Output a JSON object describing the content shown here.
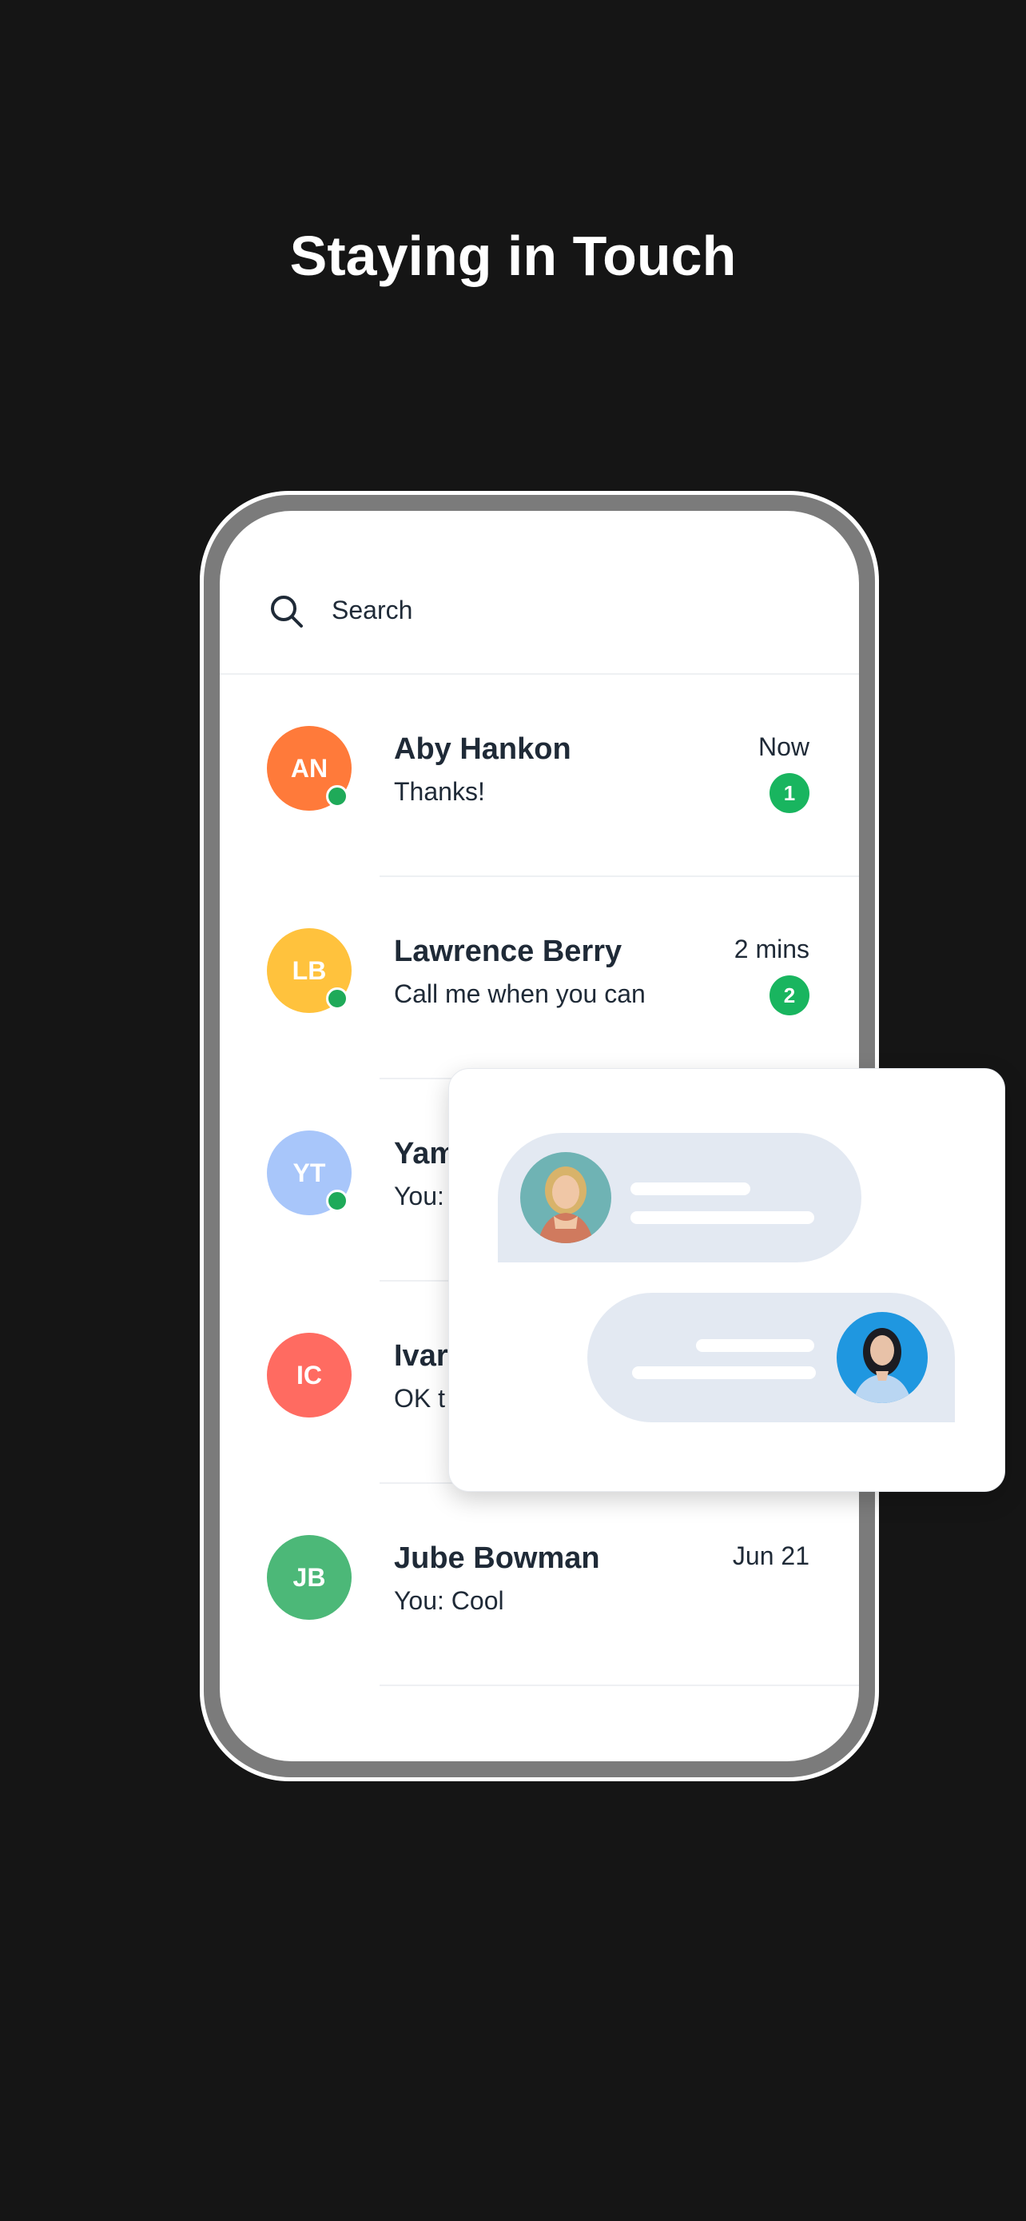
{
  "headline": "Staying in Touch",
  "search": {
    "placeholder": "Search"
  },
  "conversations": [
    {
      "initials": "AN",
      "name": "Aby Hankon",
      "message": "Thanks!",
      "time": "Now",
      "unread": "1",
      "online": true,
      "avatar_color": "#ff7a3a"
    },
    {
      "initials": "LB",
      "name": "Lawrence Berry",
      "message": "Call me when you can",
      "time": "2 mins",
      "unread": "2",
      "online": true,
      "avatar_color": "#ffc23d"
    },
    {
      "initials": "YT",
      "name": "Yam",
      "message": "You:",
      "online": true,
      "avatar_color": "#a8c6fa"
    },
    {
      "initials": "IC",
      "name": "Ivar",
      "message": "OK t",
      "online": false,
      "avatar_color": "#ff6b61"
    },
    {
      "initials": "JB",
      "name": "Jube Bowman",
      "message": "You: Cool",
      "time": "Jun 21",
      "online": false,
      "avatar_color": "#4cb878"
    }
  ],
  "colors": {
    "background": "#151515",
    "bubble": "#e3e9f2",
    "badge": "#19b55f",
    "presence": "#1faa59"
  }
}
